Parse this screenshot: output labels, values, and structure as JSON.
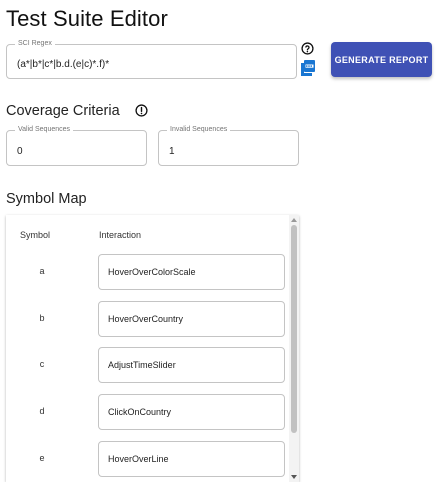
{
  "title": "Test Suite Editor",
  "regex": {
    "label": "SCI Regex",
    "value": "(a*|b*|c*|b.d.(e|c)*.f)*"
  },
  "icons": {
    "help": "help-circle-icon",
    "pdf": "pdf-file-icon",
    "alert": "alert-circle-icon"
  },
  "generate_button": {
    "label": "GENERATE REPORT"
  },
  "coverage": {
    "title": "Coverage Criteria",
    "valid": {
      "label": "Valid Sequences",
      "value": "0"
    },
    "invalid": {
      "label": "Invalid Sequences",
      "value": "1"
    }
  },
  "symbol_map": {
    "title": "Symbol Map",
    "headers": {
      "symbol": "Symbol",
      "interaction": "Interaction"
    },
    "rows": [
      {
        "symbol": "a",
        "interaction": "HoverOverColorScale"
      },
      {
        "symbol": "b",
        "interaction": "HoverOverCountry"
      },
      {
        "symbol": "c",
        "interaction": "AdjustTimeSlider"
      },
      {
        "symbol": "d",
        "interaction": "ClickOnCountry"
      },
      {
        "symbol": "e",
        "interaction": "HoverOverLine"
      }
    ]
  },
  "colors": {
    "primary": "#3f51b5",
    "border": "#c4c4c4",
    "pdf_blue": "#1976d2"
  }
}
